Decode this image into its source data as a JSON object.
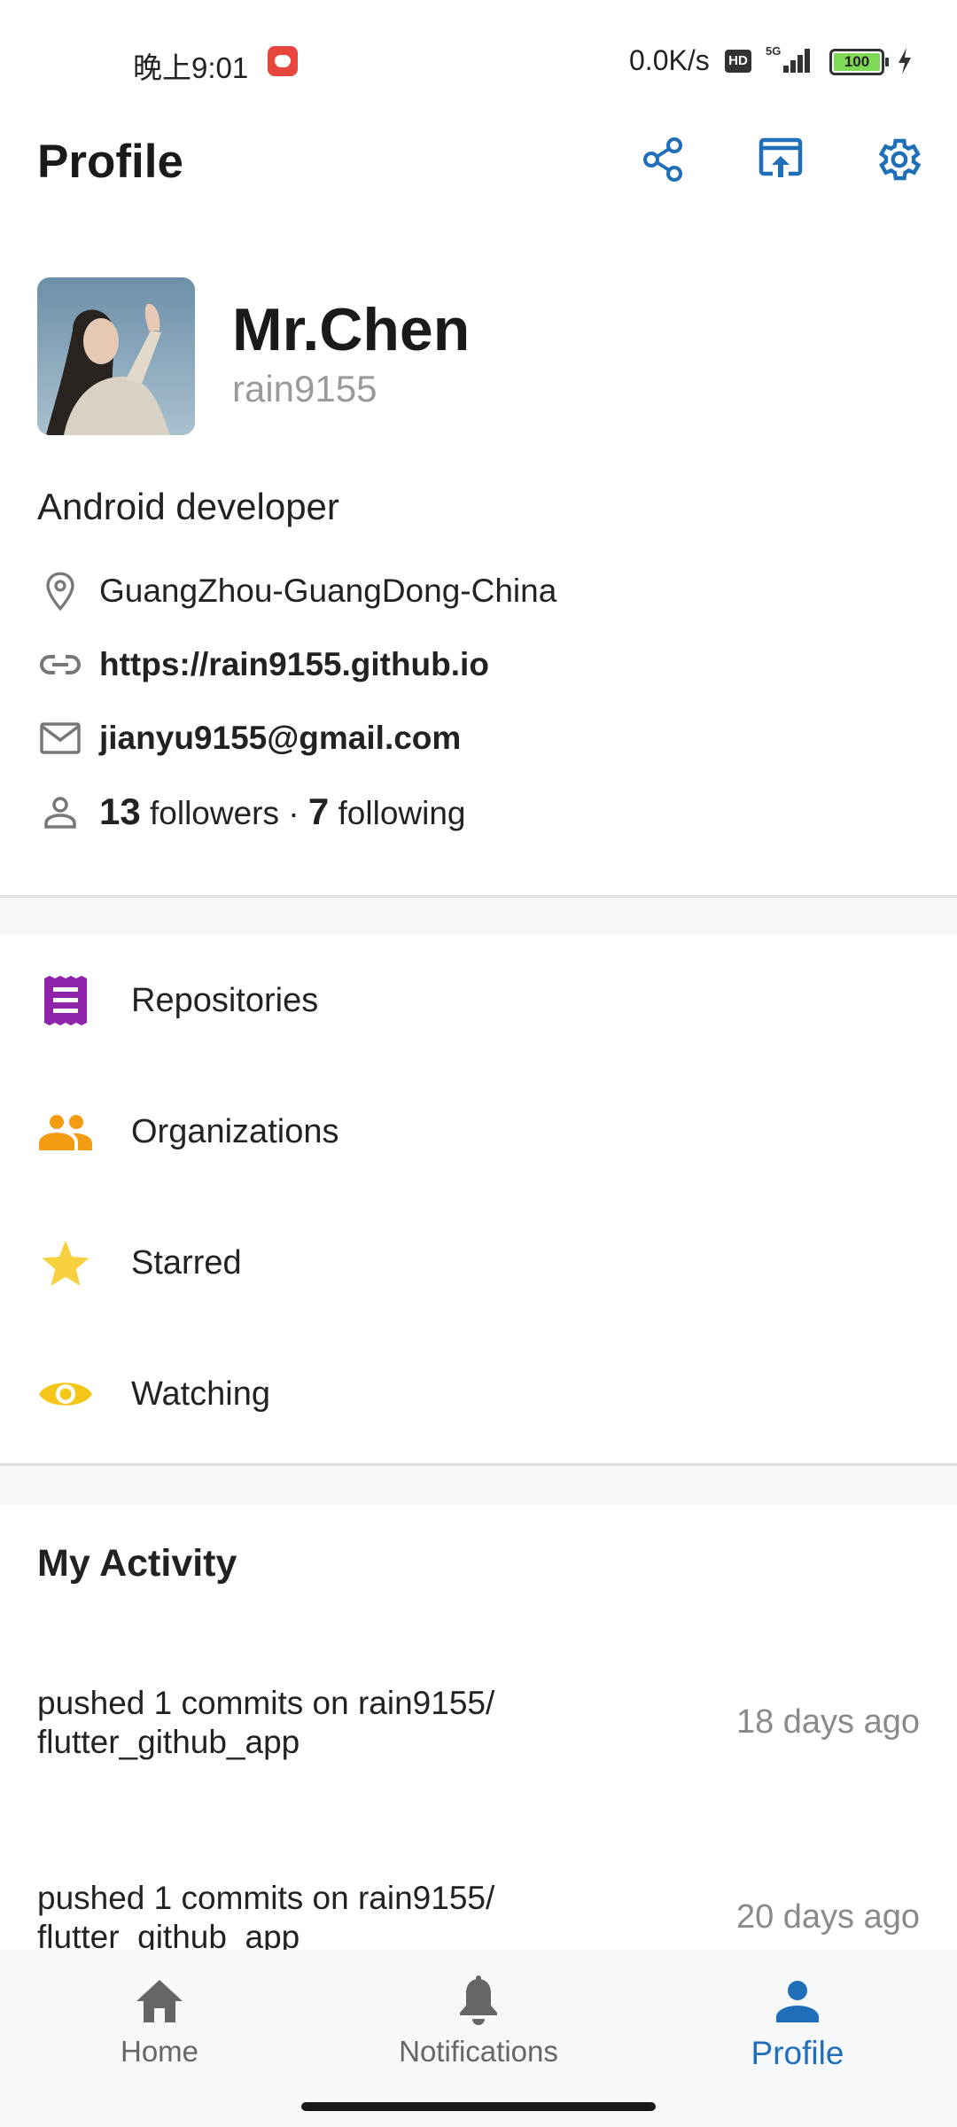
{
  "status_bar": {
    "time": "晚上9:01",
    "network_speed": "0.0K/s",
    "hd_label": "HD",
    "signal_label": "5G",
    "battery": "100"
  },
  "app_bar": {
    "title": "Profile",
    "icons": [
      "share-icon",
      "open-in-browser-icon",
      "settings-icon"
    ],
    "accent_color": "#1e6fb8"
  },
  "profile": {
    "name": "Mr.Chen",
    "login": "rain9155",
    "bio": "Android developer",
    "location": "GuangZhou-GuangDong-China",
    "blog": "https://rain9155.github.io",
    "email": "jianyu9155@gmail.com",
    "followers_count": "13",
    "followers_label": "followers",
    "separator": "·",
    "following_count": "7",
    "following_label": "following"
  },
  "menu": [
    {
      "label": "Repositories",
      "icon": "repositories-icon",
      "color": "#8e24aa"
    },
    {
      "label": "Organizations",
      "icon": "organizations-icon",
      "color": "#f39c12"
    },
    {
      "label": "Starred",
      "icon": "star-icon",
      "color": "#f7d23e"
    },
    {
      "label": "Watching",
      "icon": "eye-icon",
      "color": "#f5c518"
    }
  ],
  "activity": {
    "title": "My Activity",
    "items": [
      {
        "line1": "pushed 1 commits on rain9155/",
        "line2": "flutter_github_app",
        "time": "18 days ago"
      },
      {
        "line1": "pushed 1 commits on rain9155/",
        "line2": "flutter_github_app",
        "time": "20 days ago"
      }
    ]
  },
  "bottom_nav": {
    "items": [
      {
        "label": "Home",
        "icon": "home-icon"
      },
      {
        "label": "Notifications",
        "icon": "bell-icon"
      },
      {
        "label": "Profile",
        "icon": "person-icon"
      }
    ],
    "active": "Profile"
  }
}
